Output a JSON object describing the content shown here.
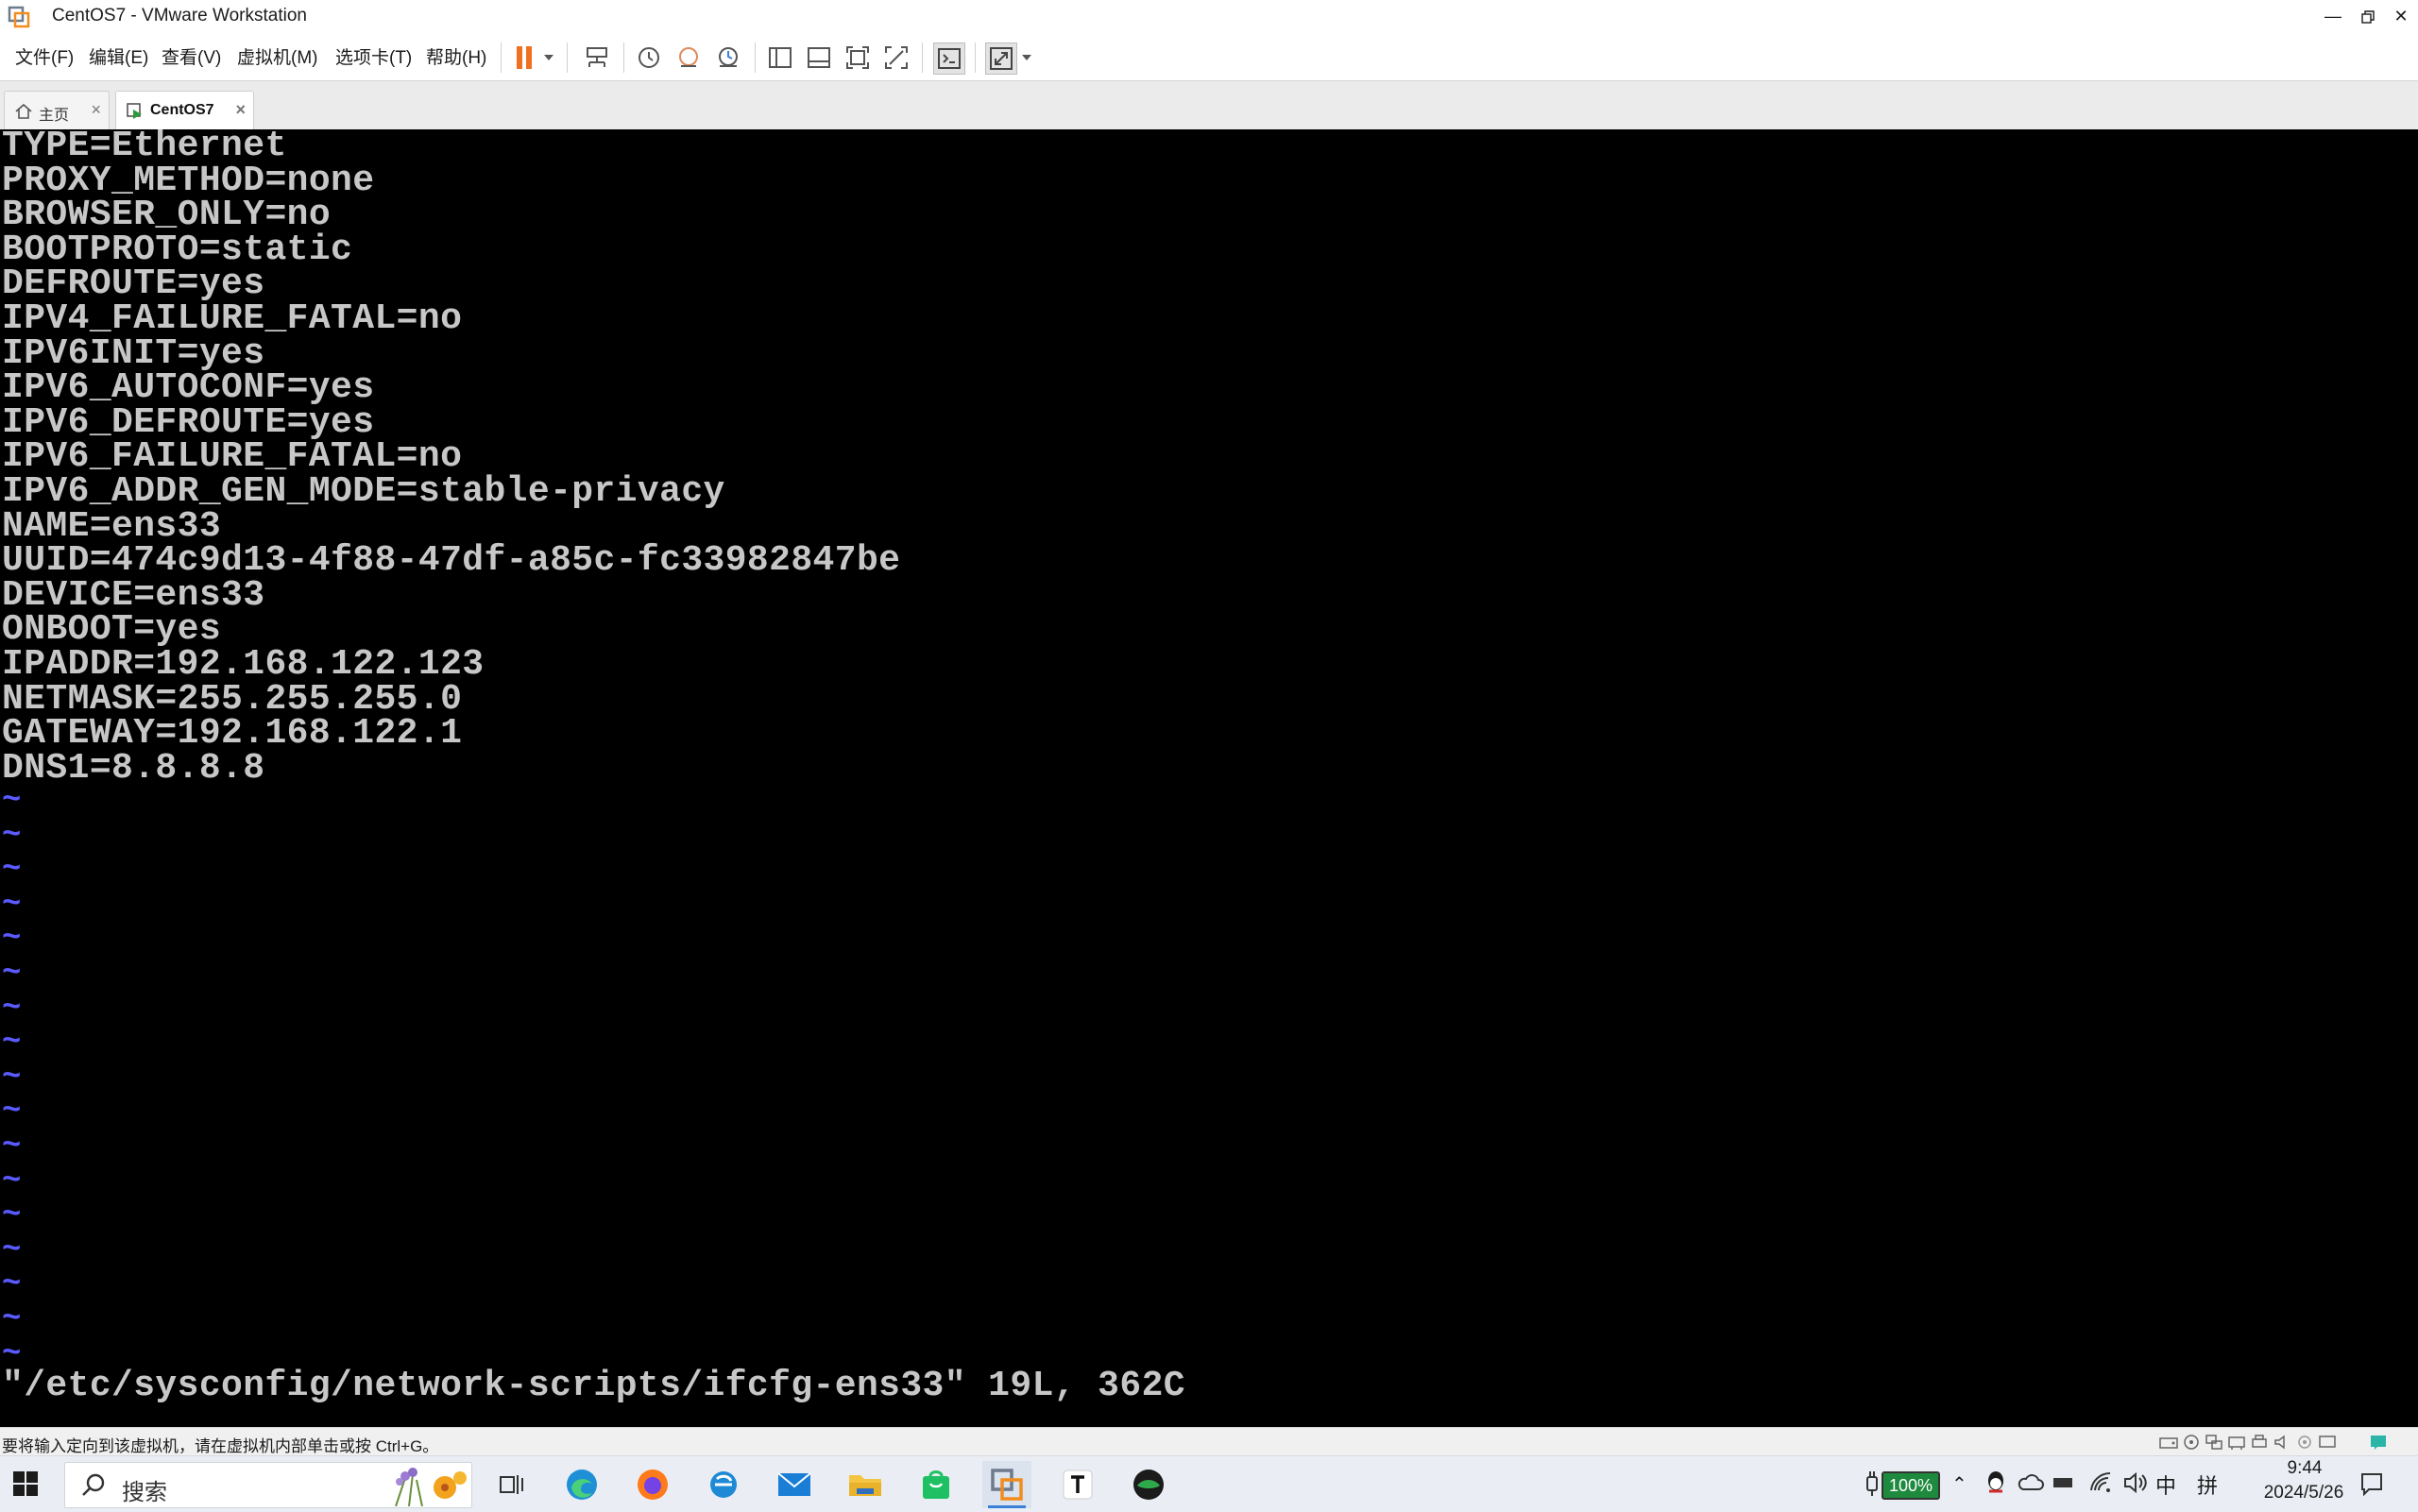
{
  "window": {
    "title": "CentOS7 - VMware Workstation"
  },
  "menu": {
    "items": [
      "文件(F)",
      "编辑(E)",
      "查看(V)",
      "虚拟机(M)",
      "选项卡(T)",
      "帮助(H)"
    ]
  },
  "tabs": [
    {
      "label": "主页",
      "active": false
    },
    {
      "label": "CentOS7",
      "active": true
    }
  ],
  "console": {
    "lines": [
      "TYPE=Ethernet",
      "PROXY_METHOD=none",
      "BROWSER_ONLY=no",
      "BOOTPROTO=static",
      "DEFROUTE=yes",
      "IPV4_FAILURE_FATAL=no",
      "IPV6INIT=yes",
      "IPV6_AUTOCONF=yes",
      "IPV6_DEFROUTE=yes",
      "IPV6_FAILURE_FATAL=no",
      "IPV6_ADDR_GEN_MODE=stable-privacy",
      "NAME=ens33",
      "UUID=474c9d13-4f88-47df-a85c-fc33982847be",
      "DEVICE=ens33",
      "ONBOOT=yes",
      "IPADDR=192.168.122.123",
      "NETMASK=255.255.255.0",
      "GATEWAY=192.168.122.1",
      "DNS1=8.8.8.8"
    ],
    "tilde_char": "~",
    "status_line": "\"/etc/sysconfig/network-scripts/ifcfg-ens33\" 19L, 362C",
    "colors": {
      "background": "#000000",
      "text": "#c7c7c7",
      "tilde": "#5a5aff"
    }
  },
  "statusbar": {
    "text": "要将输入定向到该虚拟机，请在虚拟机内部单击或按 Ctrl+G。"
  },
  "taskbar": {
    "search_placeholder": "搜索",
    "battery": "100%",
    "ime": "中",
    "ime2": "拼",
    "time": "9:44",
    "date": "2024/5/26"
  }
}
